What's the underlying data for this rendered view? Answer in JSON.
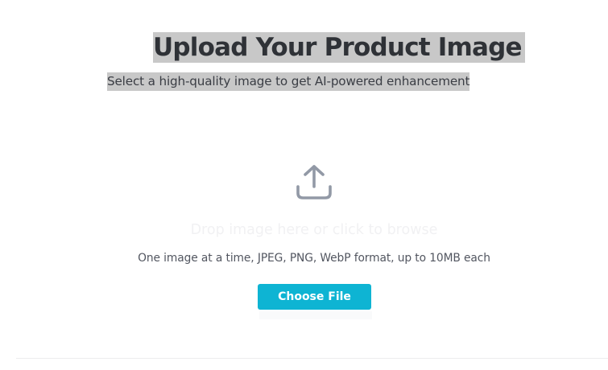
{
  "header": {
    "title": "Upload Your Product Image",
    "subtitle": "Select a high-quality image to get AI-powered enhancement"
  },
  "dropzone": {
    "icon": "upload-icon",
    "prompt": "Drop image here or click to browse",
    "hint": "One image at a time, JPEG, PNG, WebP format, up to 10MB each",
    "button_label": "Choose File"
  },
  "colors": {
    "accent": "#0eb4d3",
    "title_highlight": "#c8c8c8",
    "icon": "#9299a6"
  }
}
